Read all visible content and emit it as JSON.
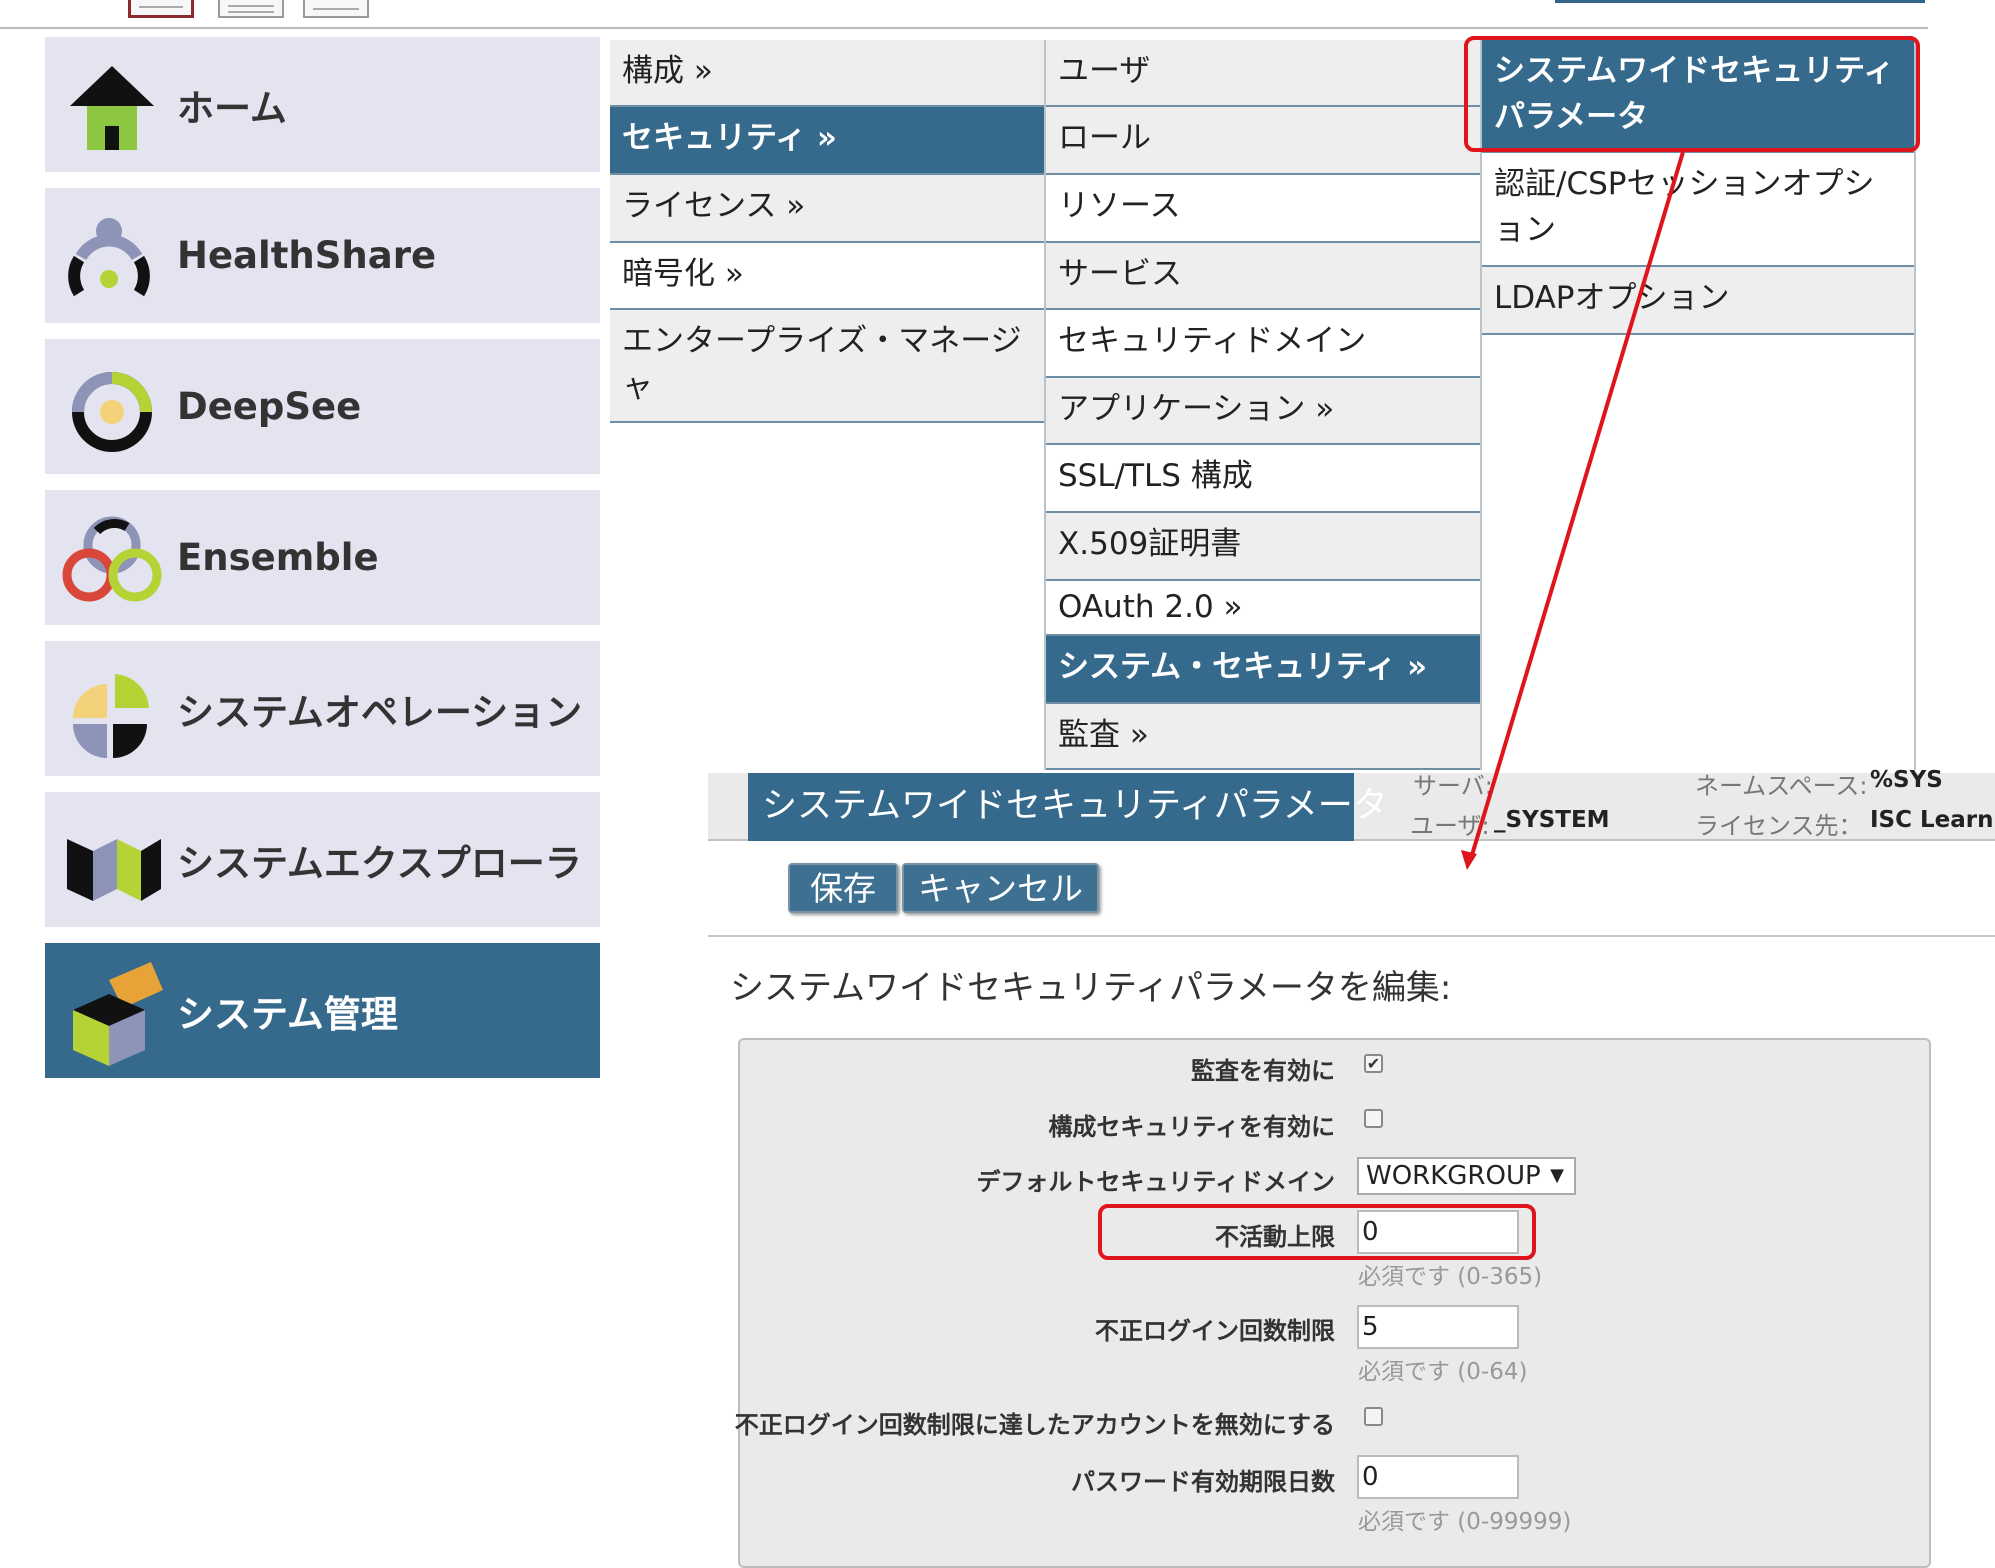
{
  "nav": {
    "items": [
      {
        "label": "ホーム"
      },
      {
        "label": "HealthShare"
      },
      {
        "label": "DeepSee"
      },
      {
        "label": "Ensemble"
      },
      {
        "label": "システムオペレーション"
      },
      {
        "label": "システムエクスプローラ"
      },
      {
        "label": "システム管理"
      }
    ]
  },
  "menu": {
    "col1": [
      "構成 »",
      "セキュリティ »",
      "ライセンス »",
      "暗号化 »",
      "エンタープライズ・マネージャ"
    ],
    "col2": [
      "ユーザ",
      "ロール",
      "リソース",
      "サービス",
      "セキュリティドメイン",
      "アプリケーション »",
      "SSL/TLS 構成",
      "X.509証明書",
      "OAuth 2.0 »",
      "システム・セキュリティ »",
      "監査 »"
    ],
    "col3": [
      "システムワイドセキュリティパラメータ",
      "認証/CSPセッションオプション",
      "LDAPオプション"
    ]
  },
  "header": {
    "title": "システムワイドセキュリティパラメータ",
    "server_label": "サーバ:",
    "user_label": "ユーザ:",
    "user_value": "_SYSTEM",
    "namespace_label": "ネームスペース:",
    "namespace_value": "%SYS",
    "license_label": "ライセンス先：",
    "license_value": "ISC Learnin"
  },
  "toolbar": {
    "save_label": "保存",
    "cancel_label": "キャンセル"
  },
  "form": {
    "title": "システムワイドセキュリティパラメータを編集:",
    "audit_label": "監査を有効に",
    "audit_checked": true,
    "config_security_label": "構成セキュリティを有効に",
    "default_domain_label": "デフォルトセキュリティドメイン",
    "default_domain_value": "WORKGROUP",
    "inactive_limit_label": "不活動上限",
    "inactive_limit_value": "0",
    "inactive_limit_hint": "必須です (0-365)",
    "invalid_login_label": "不正ログイン回数制限",
    "invalid_login_value": "5",
    "invalid_login_hint": "必須です (0-64)",
    "disable_account_label": "不正ログイン回数制限に達したアカウントを無効にする",
    "password_expire_label": "パスワード有効期限日数",
    "password_expire_value": "0",
    "password_expire_hint": "必須です (0-99999)"
  },
  "colors": {
    "accent": "#356a8c",
    "tile_bg": "#e4e4f1",
    "annotation": "#e0141c"
  }
}
